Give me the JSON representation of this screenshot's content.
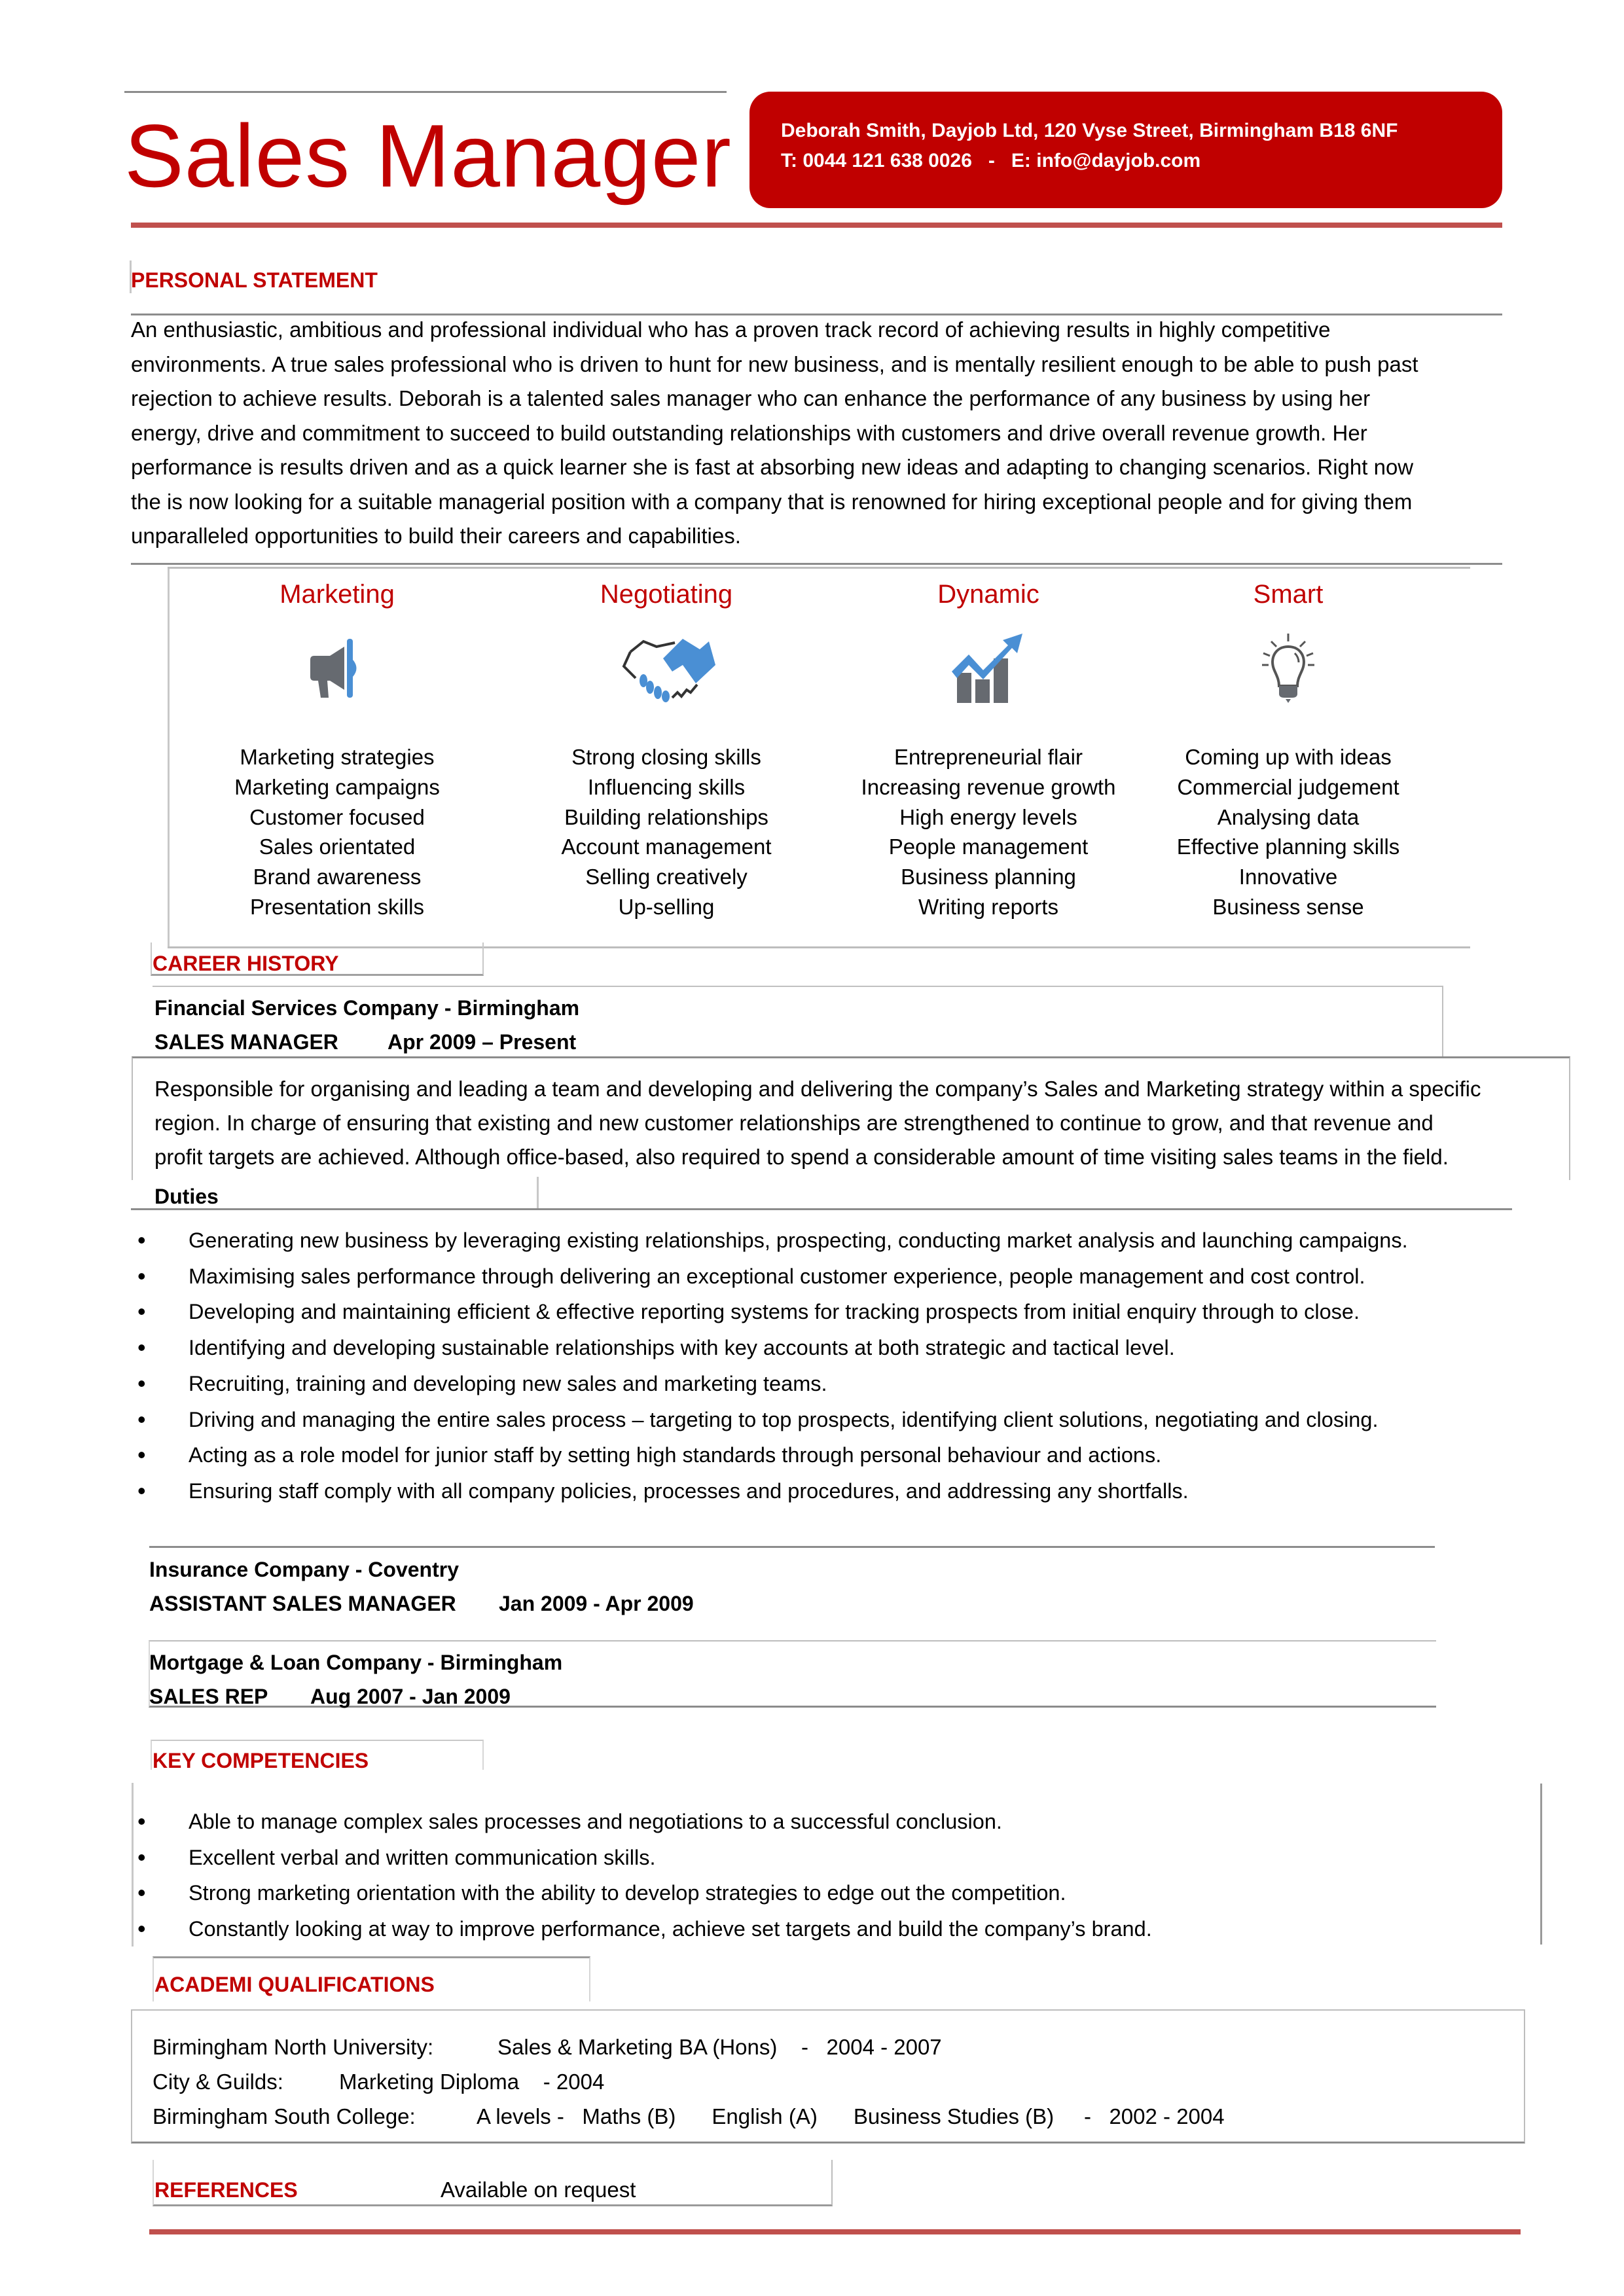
{
  "header": {
    "title": "Sales Manager",
    "contact_line1": "Deborah Smith, Dayjob Ltd, 120 Vyse Street, Birmingham B18 6NF",
    "contact_line2": "T: 0044 121 638 0026   -   E: info@dayjob.com"
  },
  "colors": {
    "accent": "#c00000",
    "rule": "#c0504d",
    "icon_blue": "#4a8fd4",
    "icon_gray": "#666a70"
  },
  "personal_statement": {
    "heading": "PERSONAL STATEMENT",
    "lines": [
      "An enthusiastic, ambitious and professional individual who has a proven track record of achieving results in highly competitive",
      "environments. A true sales professional who is driven to hunt for new business, and is mentally resilient enough to be able to push past",
      "rejection to achieve results. Deborah is a talented sales manager who can enhance the performance of any business by using her",
      "energy, drive and commitment to succeed to build outstanding relationships with customers and drive overall revenue growth. Her",
      "performance is results driven and as a quick learner she is fast at absorbing new ideas and adapting to changing scenarios. Right now",
      "the is now looking for a suitable managerial position with a company that is renowned for hiring exceptional people and for giving them",
      "unparalleled opportunities to build their careers and capabilities."
    ]
  },
  "skills": [
    {
      "title": "Marketing",
      "icon": "megaphone-icon",
      "items": [
        "Marketing strategies",
        "Marketing campaigns",
        "Customer focused",
        "Sales orientated",
        "Brand awareness",
        "Presentation skills"
      ]
    },
    {
      "title": "Negotiating",
      "icon": "handshake-icon",
      "items": [
        "Strong closing skills",
        "Influencing skills",
        "Building relationships",
        "Account management",
        "Selling creatively",
        "Up-selling"
      ]
    },
    {
      "title": "Dynamic",
      "icon": "growth-chart-icon",
      "items": [
        "Entrepreneurial flair",
        "Increasing revenue growth",
        "High energy levels",
        "People management",
        "Business planning",
        "Writing reports"
      ]
    },
    {
      "title": "Smart",
      "icon": "lightbulb-icon",
      "items": [
        "Coming up with ideas",
        "Commercial judgement",
        "Analysing data",
        "Effective planning skills",
        "Innovative",
        "Business sense"
      ]
    }
  ],
  "career_history": {
    "heading": "CAREER HISTORY",
    "jobs": [
      {
        "company": "Financial Services Company - Birmingham",
        "role": "SALES MANAGER",
        "dates": "Apr 2009 – Present",
        "summary": [
          "Responsible for organising and leading a team and developing and delivering the company’s Sales and Marketing strategy within a specific",
          "region. In charge of ensuring that existing and new customer relationships are strengthened to continue to grow, and that revenue and",
          "profit targets are achieved. Although office-based, also required to spend a considerable amount of time visiting sales teams in the field."
        ],
        "duties_label": "Duties",
        "duties": [
          "Generating new business by leveraging existing relationships, prospecting, conducting market analysis and launching campaigns.",
          "Maximising sales performance through delivering an exceptional customer experience, people management and cost control.",
          "Developing and maintaining efficient & effective reporting systems for tracking prospects from initial enquiry through to close.",
          "Identifying and developing sustainable relationships with key accounts at both strategic and tactical level.",
          "Recruiting, training and developing new sales and marketing teams.",
          "Driving and managing the entire sales process – targeting to top prospects, identifying client solutions, negotiating and closing.",
          "Acting as a role model for junior staff by setting high standards through personal behaviour and actions.",
          "Ensuring staff comply with all company policies, processes and procedures, and addressing any shortfalls."
        ]
      },
      {
        "company": "Insurance Company - Coventry",
        "role": "ASSISTANT SALES MANAGER",
        "dates": "Jan 2009 - Apr 2009"
      },
      {
        "company": "Mortgage & Loan Company - Birmingham",
        "role": "SALES REP",
        "dates": "Aug 2007 - Jan 2009"
      }
    ]
  },
  "key_competencies": {
    "heading": "KEY COMPETENCIES",
    "items": [
      "Able to manage complex sales processes and negotiations to a successful conclusion.",
      "Excellent verbal and written communication skills.",
      "Strong marketing orientation with the ability to develop strategies to edge out the competition.",
      "Constantly looking at way to improve performance, achieve set targets and build the company’s brand."
    ]
  },
  "qualifications": {
    "heading": "ACADEMI QUALIFICATIONS",
    "rows": [
      {
        "institution": "Birmingham North University:",
        "detail": "Sales & Marketing BA (Hons)    -   2004 - 2007"
      },
      {
        "institution": "City & Guilds:",
        "detail": "Marketing Diploma    - 2004"
      },
      {
        "institution": "Birmingham South College:",
        "detail": "A levels -   Maths (B)      English (A)      Business Studies (B)     -   2002 - 2004"
      }
    ]
  },
  "references": {
    "heading": "REFERENCES",
    "value": "Available on request"
  }
}
